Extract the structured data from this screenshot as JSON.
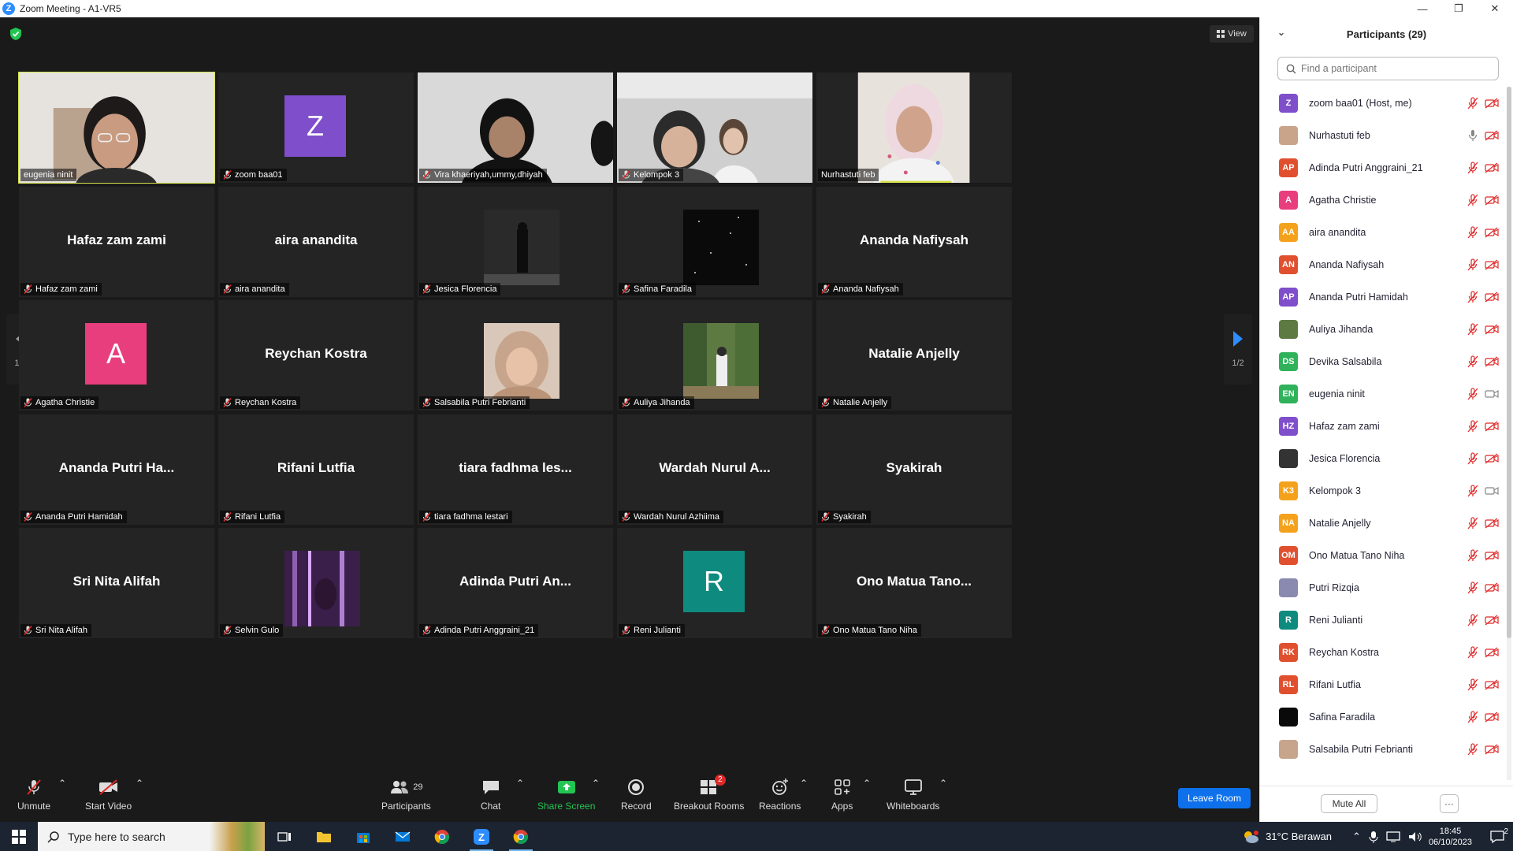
{
  "window": {
    "title": "Zoom Meeting - A1-VR5",
    "controls": [
      "—",
      "❐",
      "✕"
    ]
  },
  "meeting": {
    "view_label": "View",
    "page_indicator": "1/2",
    "tiles": [
      {
        "kind": "video",
        "label": "eugenia ninit",
        "active": true,
        "muted": false,
        "scene": "girl-glasses"
      },
      {
        "kind": "avatar",
        "label": "zoom baa01",
        "letter": "Z",
        "color": "#7f4ecb",
        "muted": true
      },
      {
        "kind": "video",
        "label": "Vira khaeriyah,ummy,dhiyah",
        "muted": true,
        "scene": "group-hijab"
      },
      {
        "kind": "video",
        "label": "Kelompok 3",
        "muted": true,
        "scene": "two-girls"
      },
      {
        "kind": "video",
        "label": "Nurhastuti feb",
        "muted": false,
        "scene": "woman-floral"
      },
      {
        "kind": "name",
        "big": "Hafaz zam zami",
        "label": "Hafaz zam zami",
        "muted": true
      },
      {
        "kind": "name",
        "big": "aira anandita",
        "label": "aira anandita",
        "muted": true
      },
      {
        "kind": "photo",
        "label": "Jesica Florencia",
        "muted": true,
        "scene": "dark-figure"
      },
      {
        "kind": "photo",
        "label": "Safina Faradila",
        "muted": true,
        "scene": "stars"
      },
      {
        "kind": "name",
        "big": "Ananda Nafiysah",
        "label": "Ananda Nafiysah",
        "muted": true
      },
      {
        "kind": "avatar",
        "label": "Agatha Christie",
        "letter": "A",
        "color": "#e83e7d",
        "muted": true
      },
      {
        "kind": "name",
        "big": "Reychan Kostra",
        "label": "Reychan Kostra",
        "muted": true
      },
      {
        "kind": "photo",
        "label": "Salsabila Putri Febrianti",
        "muted": true,
        "scene": "hijab-portrait"
      },
      {
        "kind": "photo",
        "label": "Auliya Jihanda",
        "muted": true,
        "scene": "forest"
      },
      {
        "kind": "name",
        "big": "Natalie Anjelly",
        "label": "Natalie Anjelly",
        "muted": true
      },
      {
        "kind": "name",
        "big": "Ananda Putri Ha...",
        "label": "Ananda Putri Hamidah",
        "muted": true
      },
      {
        "kind": "name",
        "big": "Rifani Lutfia",
        "label": "Rifani Lutfia",
        "muted": true
      },
      {
        "kind": "name",
        "big": "tiara fadhma les...",
        "label": "tiara fadhma lestari",
        "muted": true
      },
      {
        "kind": "name",
        "big": "Wardah Nurul A...",
        "label": "Wardah Nurul Azhiima",
        "muted": true
      },
      {
        "kind": "name",
        "big": "Syakirah",
        "label": "Syakirah",
        "muted": true
      },
      {
        "kind": "name",
        "big": "Sri Nita Alifah",
        "label": "Sri Nita Alifah",
        "muted": true
      },
      {
        "kind": "photo",
        "label": "Selvin Gulo",
        "muted": true,
        "scene": "purple-lights"
      },
      {
        "kind": "name",
        "big": "Adinda Putri An...",
        "label": "Adinda Putri Anggraini_21",
        "muted": true
      },
      {
        "kind": "avatar",
        "label": "Reni Julianti",
        "letter": "R",
        "color": "#0f8a7e",
        "muted": true
      },
      {
        "kind": "name",
        "big": "Ono Matua Tano...",
        "label": "Ono Matua Tano Niha",
        "muted": true
      }
    ]
  },
  "toolbar": {
    "unmute": "Unmute",
    "start_video": "Start Video",
    "participants": "Participants",
    "participants_count": "29",
    "chat": "Chat",
    "share_screen": "Share Screen",
    "record": "Record",
    "breakout_rooms": "Breakout Rooms",
    "breakout_badge": "2",
    "reactions": "Reactions",
    "apps": "Apps",
    "whiteboards": "Whiteboards",
    "leave_room": "Leave Room"
  },
  "panel": {
    "title": "Participants (29)",
    "search_placeholder": "Find a participant",
    "mute_all": "Mute All",
    "more": "···",
    "participants": [
      {
        "initials": "Z",
        "color": "#7f4ecb",
        "name": "zoom baa01 (Host, me)",
        "mic": "muted",
        "cam": "off"
      },
      {
        "initials": "",
        "photo": "#c9a48a",
        "name": "Nurhastuti feb",
        "mic": "on",
        "cam": "off"
      },
      {
        "initials": "AP",
        "color": "#e0502f",
        "name": "Adinda Putri Anggraini_21",
        "mic": "muted",
        "cam": "off"
      },
      {
        "initials": "A",
        "color": "#e83e7d",
        "name": "Agatha Christie",
        "mic": "muted",
        "cam": "off"
      },
      {
        "initials": "AA",
        "color": "#f4a21c",
        "name": "aira anandita",
        "mic": "muted",
        "cam": "off"
      },
      {
        "initials": "AN",
        "color": "#e0502f",
        "name": "Ananda Nafiysah",
        "mic": "muted",
        "cam": "off"
      },
      {
        "initials": "AP",
        "color": "#7f4ecb",
        "name": "Ananda Putri Hamidah",
        "mic": "muted",
        "cam": "off"
      },
      {
        "initials": "",
        "photo": "#5e7a43",
        "name": "Auliya Jihanda",
        "mic": "muted",
        "cam": "off"
      },
      {
        "initials": "DS",
        "color": "#2fb25a",
        "name": "Devika Salsabila",
        "mic": "muted",
        "cam": "off"
      },
      {
        "initials": "EN",
        "color": "#2fb25a",
        "name": "eugenia ninit",
        "mic": "muted",
        "cam": "on"
      },
      {
        "initials": "HZ",
        "color": "#7f4ecb",
        "name": "Hafaz zam zami",
        "mic": "muted",
        "cam": "off"
      },
      {
        "initials": "",
        "photo": "#333333",
        "name": "Jesica Florencia",
        "mic": "muted",
        "cam": "off"
      },
      {
        "initials": "K3",
        "color": "#f4a21c",
        "name": "Kelompok 3",
        "mic": "muted",
        "cam": "on"
      },
      {
        "initials": "NA",
        "color": "#f4a21c",
        "name": "Natalie Anjelly",
        "mic": "muted",
        "cam": "off"
      },
      {
        "initials": "OM",
        "color": "#e0502f",
        "name": "Ono Matua Tano Niha",
        "mic": "muted",
        "cam": "off"
      },
      {
        "initials": "",
        "photo": "#8a8ab0",
        "name": "Putri Rizqia",
        "mic": "muted",
        "cam": "off"
      },
      {
        "initials": "R",
        "color": "#0f8a7e",
        "name": "Reni Julianti",
        "mic": "muted",
        "cam": "off"
      },
      {
        "initials": "RK",
        "color": "#e0502f",
        "name": "Reychan Kostra",
        "mic": "muted",
        "cam": "off"
      },
      {
        "initials": "RL",
        "color": "#e0502f",
        "name": "Rifani Lutfia",
        "mic": "muted",
        "cam": "off"
      },
      {
        "initials": "",
        "photo": "#0a0a0a",
        "name": "Safina Faradila",
        "mic": "muted",
        "cam": "off"
      },
      {
        "initials": "",
        "photo": "#c7a58c",
        "name": "Salsabila Putri Febrianti",
        "mic": "muted",
        "cam": "off"
      }
    ]
  },
  "taskbar": {
    "search_placeholder": "Type here to search",
    "weather": "31°C  Berawan",
    "time": "18:45",
    "date": "06/10/2023",
    "notification_count": "2"
  },
  "colors": {
    "leave": "#0e71eb",
    "muted_red": "#e02828",
    "active_border": "#d7e34b",
    "share_green": "#23c552"
  }
}
